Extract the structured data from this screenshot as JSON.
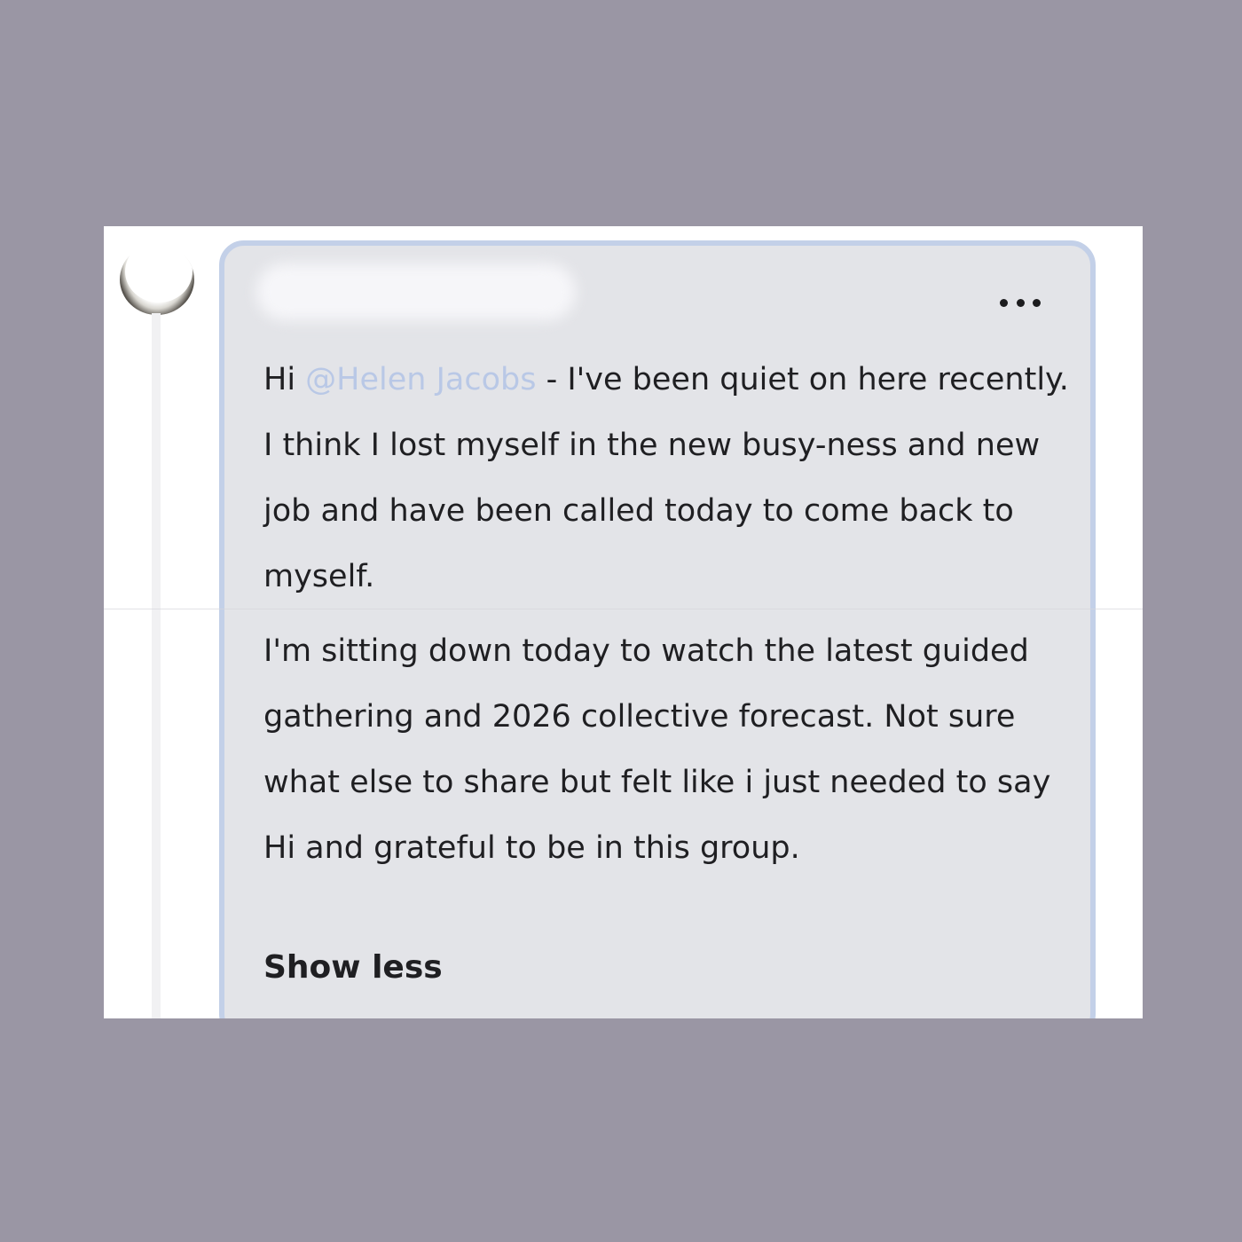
{
  "comment": {
    "mention_prefix": "Hi ",
    "mention": "@Helen Jacobs",
    "paragraph_1_rest": " - I've been quiet on here recently. I think I lost myself in the new busy-ness and new job and have been called today to come back to myself.",
    "paragraph_2": "I'm sitting down today to watch the latest guided gathering and 2026 collective forecast. Not sure what else to share but felt like i just needed to say Hi and grateful to be in this group.",
    "show_less_label": "Show less"
  },
  "icons": {
    "more_options": "more-horizontal-icon",
    "avatar": "moon-avatar"
  },
  "colors": {
    "background": "#9a96a4",
    "bubble": "#e3e4e8",
    "bubble_border": "#c3d0e8",
    "mention": "#b9c8e6",
    "text": "#1f1f22"
  }
}
